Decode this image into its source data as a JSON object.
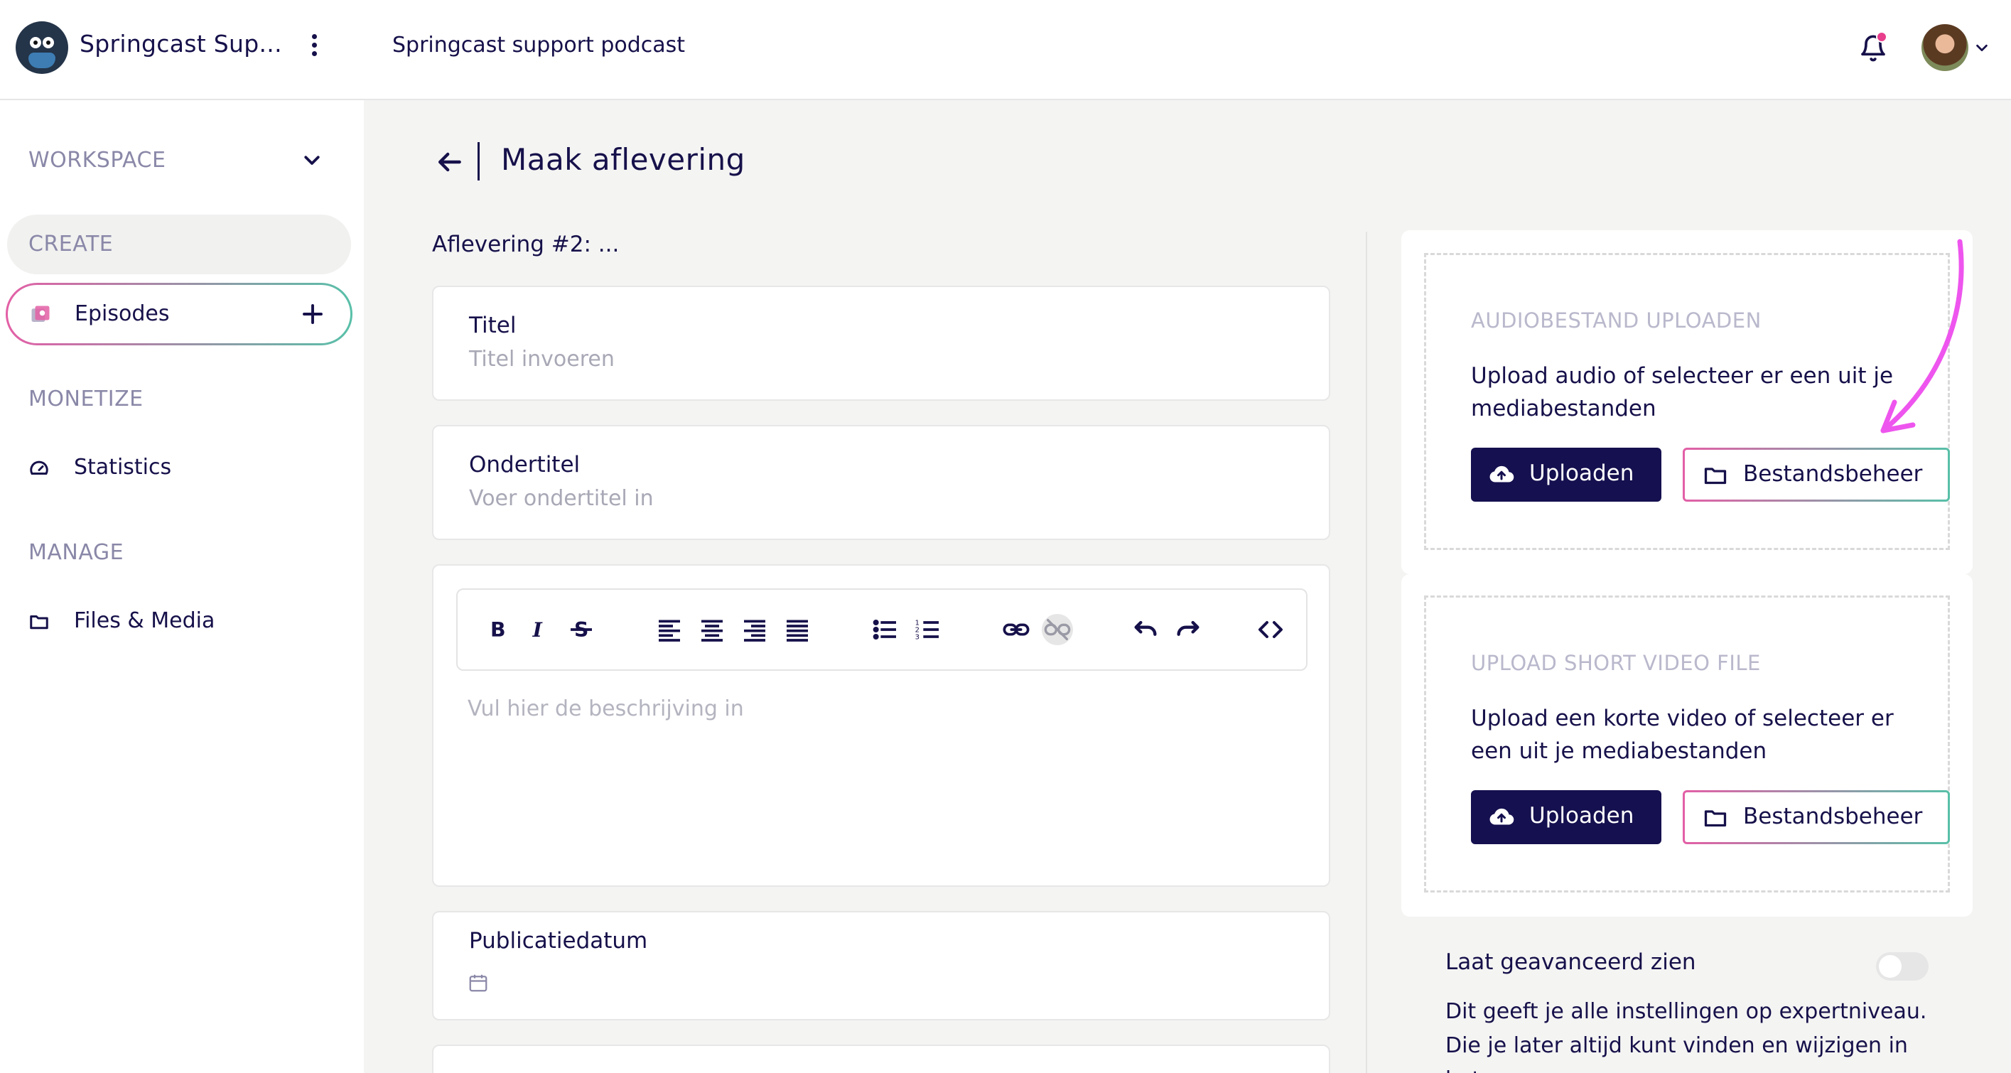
{
  "header": {
    "app_title": "Springcast Sup...",
    "podcast_title": "Springcast support podcast",
    "icons": [
      "springcast-logo",
      "more-vertical-icon",
      "bell-icon",
      "avatar",
      "chevron-down-icon"
    ],
    "notification_dot_color": "#e83e8c"
  },
  "sidebar": {
    "workspace_label": "WORKSPACE",
    "create_label": "CREATE",
    "episodes_label": "Episodes",
    "monetize_label": "MONETIZE",
    "statistics_label": "Statistics",
    "manage_label": "MANAGE",
    "files_label": "Files & Media"
  },
  "main": {
    "page_title": "Maak aflevering",
    "episode_label": "Aflevering #2: ...",
    "title_field": {
      "label": "Titel",
      "placeholder": "Titel invoeren"
    },
    "subtitle_field": {
      "label": "Ondertitel",
      "placeholder": "Voer ondertitel in"
    },
    "editor": {
      "placeholder": "Vul hier de beschrijving in",
      "toolbar_icons": [
        "bold-icon",
        "italic-icon",
        "strikethrough-icon",
        "align-left-icon",
        "align-center-icon",
        "align-right-icon",
        "align-justify-icon",
        "bullet-list-icon",
        "numbered-list-icon",
        "link-icon",
        "unlink-icon",
        "undo-icon",
        "redo-icon",
        "code-icon"
      ]
    },
    "date_field": {
      "label": "Publicatiedatum"
    }
  },
  "upload": {
    "audio": {
      "title": "AUDIOBESTAND UPLOADEN",
      "description": "Upload audio of selecteer er een uit je mediabestanden",
      "upload_button": "Uploaden",
      "browse_button": "Bestandsbeheer"
    },
    "video": {
      "title": "UPLOAD SHORT VIDEO FILE",
      "description": "Upload een korte video of selecteer er een uit je mediabestanden",
      "upload_button": "Uploaden",
      "browse_button": "Bestandsbeheer"
    },
    "advanced": {
      "label": "Laat geavanceerd zien",
      "toggle_on": false,
      "description": "Dit geeft je alle instellingen op expertniveau. Die je later altijd kunt vinden en wijzigen in het"
    }
  },
  "colors": {
    "primary": "#15104f",
    "accent_pink": "#e35fa6",
    "accent_teal": "#58c0a8",
    "annotation_arrow": "#ee55ee"
  }
}
